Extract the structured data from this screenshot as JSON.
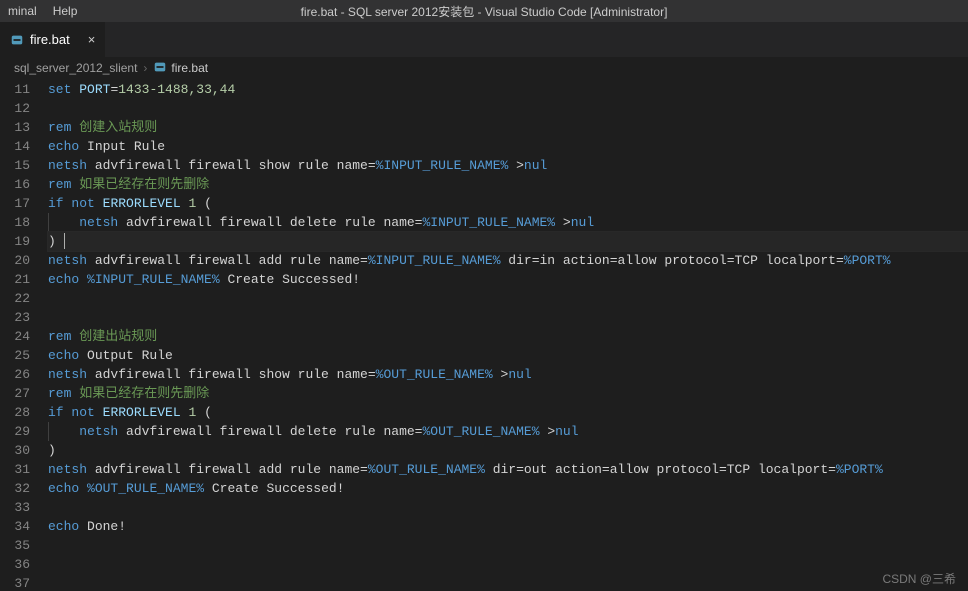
{
  "menubar": {
    "terminal": "minal",
    "help": "Help"
  },
  "title": "fire.bat - SQL server 2012安装包 - Visual Studio Code [Administrator]",
  "tab": {
    "name": "fire.bat",
    "close": "×"
  },
  "breadcrumb": {
    "folder": "sql_server_2012_slient",
    "sep": "›",
    "file": "fire.bat"
  },
  "watermark": "CSDN @三希",
  "lines": [
    {
      "num": 11,
      "tokens": [
        [
          "cmd",
          "set"
        ],
        [
          "text",
          " "
        ],
        [
          "var",
          "PORT"
        ],
        [
          "pun",
          "="
        ],
        [
          "num",
          "1433-1488,33,44"
        ]
      ]
    },
    {
      "num": 12,
      "tokens": []
    },
    {
      "num": 13,
      "tokens": [
        [
          "cmd",
          "rem"
        ],
        [
          "cmt",
          " 创建入站规则"
        ]
      ]
    },
    {
      "num": 14,
      "tokens": [
        [
          "cmd",
          "echo"
        ],
        [
          "text",
          " Input Rule"
        ]
      ]
    },
    {
      "num": 15,
      "tokens": [
        [
          "cmd",
          "netsh"
        ],
        [
          "text",
          " advfirewall firewall show rule name="
        ],
        [
          "envvar",
          "%INPUT_RULE_NAME%"
        ],
        [
          "text",
          " >"
        ],
        [
          "nul",
          "nul"
        ]
      ]
    },
    {
      "num": 16,
      "tokens": [
        [
          "cmd",
          "rem"
        ],
        [
          "cmt",
          " 如果已经存在则先删除"
        ]
      ]
    },
    {
      "num": 17,
      "tokens": [
        [
          "kw",
          "if"
        ],
        [
          "text",
          " "
        ],
        [
          "kw",
          "not"
        ],
        [
          "text",
          " "
        ],
        [
          "var",
          "ERRORLEVEL"
        ],
        [
          "text",
          " "
        ],
        [
          "num",
          "1"
        ],
        [
          "text",
          " "
        ],
        [
          "pun",
          "("
        ]
      ]
    },
    {
      "num": 18,
      "indent": true,
      "tokens": [
        [
          "text",
          "    "
        ],
        [
          "cmd",
          "netsh"
        ],
        [
          "text",
          " advfirewall firewall delete rule name="
        ],
        [
          "envvar",
          "%INPUT_RULE_NAME%"
        ],
        [
          "text",
          " >"
        ],
        [
          "nul",
          "nul"
        ]
      ]
    },
    {
      "num": 19,
      "current": true,
      "tokens": [
        [
          "pun",
          ")"
        ],
        [
          "text",
          " "
        ],
        [
          "cursor",
          ""
        ]
      ]
    },
    {
      "num": 20,
      "tokens": [
        [
          "cmd",
          "netsh"
        ],
        [
          "text",
          " advfirewall firewall add rule name="
        ],
        [
          "envvar",
          "%INPUT_RULE_NAME%"
        ],
        [
          "text",
          " dir=in action=allow protocol=TCP localport="
        ],
        [
          "envvar",
          "%PORT%"
        ]
      ]
    },
    {
      "num": 21,
      "tokens": [
        [
          "cmd",
          "echo"
        ],
        [
          "text",
          " "
        ],
        [
          "envvar",
          "%INPUT_RULE_NAME%"
        ],
        [
          "text",
          " Create Successed!"
        ]
      ]
    },
    {
      "num": 22,
      "tokens": []
    },
    {
      "num": 23,
      "tokens": []
    },
    {
      "num": 24,
      "tokens": [
        [
          "cmd",
          "rem"
        ],
        [
          "cmt",
          " 创建出站规则"
        ]
      ]
    },
    {
      "num": 25,
      "tokens": [
        [
          "cmd",
          "echo"
        ],
        [
          "text",
          " Output Rule"
        ]
      ]
    },
    {
      "num": 26,
      "tokens": [
        [
          "cmd",
          "netsh"
        ],
        [
          "text",
          " advfirewall firewall show rule name="
        ],
        [
          "envvar",
          "%OUT_RULE_NAME%"
        ],
        [
          "text",
          " >"
        ],
        [
          "nul",
          "nul"
        ]
      ]
    },
    {
      "num": 27,
      "tokens": [
        [
          "cmd",
          "rem"
        ],
        [
          "cmt",
          " 如果已经存在则先删除"
        ]
      ]
    },
    {
      "num": 28,
      "tokens": [
        [
          "kw",
          "if"
        ],
        [
          "text",
          " "
        ],
        [
          "kw",
          "not"
        ],
        [
          "text",
          " "
        ],
        [
          "var",
          "ERRORLEVEL"
        ],
        [
          "text",
          " "
        ],
        [
          "num",
          "1"
        ],
        [
          "text",
          " "
        ],
        [
          "pun",
          "("
        ]
      ]
    },
    {
      "num": 29,
      "indent": true,
      "tokens": [
        [
          "text",
          "    "
        ],
        [
          "cmd",
          "netsh"
        ],
        [
          "text",
          " advfirewall firewall delete rule name="
        ],
        [
          "envvar",
          "%OUT_RULE_NAME%"
        ],
        [
          "text",
          " >"
        ],
        [
          "nul",
          "nul"
        ]
      ]
    },
    {
      "num": 30,
      "tokens": [
        [
          "pun",
          ")"
        ]
      ]
    },
    {
      "num": 31,
      "tokens": [
        [
          "cmd",
          "netsh"
        ],
        [
          "text",
          " advfirewall firewall add rule name="
        ],
        [
          "envvar",
          "%OUT_RULE_NAME%"
        ],
        [
          "text",
          " dir=out action=allow protocol=TCP localport="
        ],
        [
          "envvar",
          "%PORT%"
        ]
      ]
    },
    {
      "num": 32,
      "tokens": [
        [
          "cmd",
          "echo"
        ],
        [
          "text",
          " "
        ],
        [
          "envvar",
          "%OUT_RULE_NAME%"
        ],
        [
          "text",
          " Create Successed!"
        ]
      ]
    },
    {
      "num": 33,
      "tokens": []
    },
    {
      "num": 34,
      "tokens": [
        [
          "cmd",
          "echo"
        ],
        [
          "text",
          " Done!"
        ]
      ]
    },
    {
      "num": 35,
      "tokens": []
    },
    {
      "num": 36,
      "tokens": []
    },
    {
      "num": 37,
      "tokens": []
    }
  ]
}
